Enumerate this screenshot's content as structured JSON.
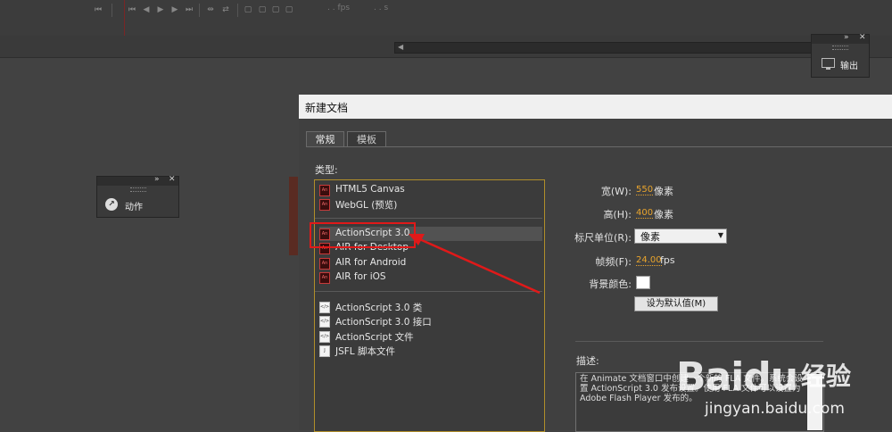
{
  "timeline": {
    "fps_label": ". . fps",
    "sec_label": ". . s"
  },
  "output_panel": {
    "label": "输出"
  },
  "actions_panel": {
    "label": "动作"
  },
  "dialog": {
    "title": "新建文档",
    "tabs": [
      {
        "label": "常规"
      },
      {
        "label": "模板"
      }
    ],
    "type_label": "类型:",
    "types_group1": [
      {
        "label": "HTML5 Canvas"
      },
      {
        "label": "WebGL (预览)"
      }
    ],
    "types_group2": [
      {
        "label": "ActionScript 3.0"
      },
      {
        "label": "AIR for Desktop"
      },
      {
        "label": "AIR for Android"
      },
      {
        "label": "AIR for iOS"
      }
    ],
    "types_group3": [
      {
        "label": "ActionScript 3.0 类"
      },
      {
        "label": "ActionScript 3.0 接口"
      },
      {
        "label": "ActionScript 文件"
      },
      {
        "label": "JSFL 脚本文件"
      }
    ],
    "width_label": "宽(W):",
    "width_value": "550",
    "width_unit": "像素",
    "height_label": "高(H):",
    "height_value": "400",
    "height_unit": "像素",
    "ruler_label": "标尺单位(R):",
    "ruler_value": "像素",
    "fps_label": "帧频(F):",
    "fps_value": "24.00",
    "fps_unit": "fps",
    "bg_label": "背景颜色:",
    "bg_color": "#ffffff",
    "default_button": "设为默认值(M)",
    "desc_label": "描述:",
    "desc_text": "在 Animate 文档窗口中创建一个新的 FLA 文件。系统会设置 ActionScript 3.0 发布设置。使用 FLA 文件可以设置为 Adobe Flash Player 发布的。"
  },
  "watermark": {
    "brand": "Baidu",
    "cn": "经验",
    "url": "jingyan.baidu.com"
  },
  "colors": {
    "accent_value": "#e9a42c",
    "highlight_red": "#e01919"
  }
}
